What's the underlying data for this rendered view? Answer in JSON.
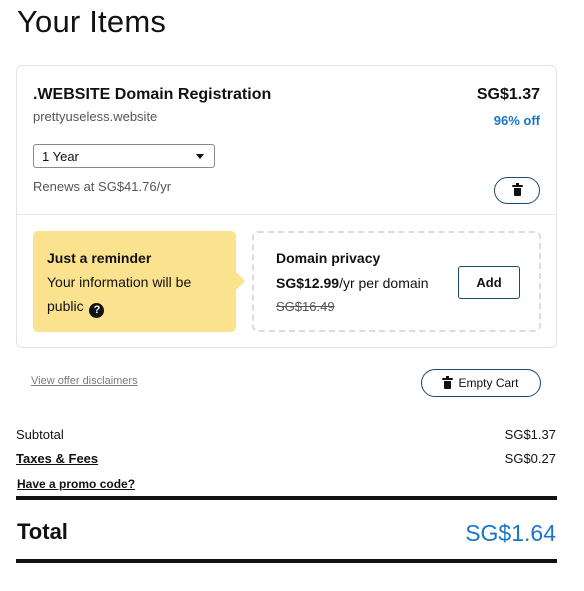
{
  "page": {
    "title": "Your Items"
  },
  "item": {
    "name": ".WEBSITE Domain Registration",
    "domain": "prettyuseless.website",
    "price": "SG$1.37",
    "discount": "96% off",
    "term_selected": "1 Year",
    "renews_text": "Renews at SG$41.76/yr"
  },
  "reminder": {
    "title": "Just a reminder",
    "text": "Your information will be public"
  },
  "privacy": {
    "title": "Domain privacy",
    "price": "SG$12.99",
    "price_suffix": "/yr per domain",
    "old_price": "SG$16.49",
    "add_label": "Add"
  },
  "actions": {
    "disclaimers_label": "View offer disclaimers",
    "empty_cart_label": "Empty Cart"
  },
  "summary": {
    "subtotal_label": "Subtotal",
    "subtotal_value": "SG$1.37",
    "taxes_label": "Taxes & Fees",
    "taxes_value": "SG$0.27",
    "promo_label": "Have a promo code?",
    "total_label": "Total",
    "total_value": "SG$1.64"
  },
  "icons": {
    "delete": "trash-icon",
    "empty_cart": "trash-icon",
    "help": "question-circle-icon",
    "select": "chevron-down-icon"
  },
  "colors": {
    "accent": "#1976c9",
    "reminder_bg": "#fbe28e",
    "button_border": "#1b4a6f"
  }
}
